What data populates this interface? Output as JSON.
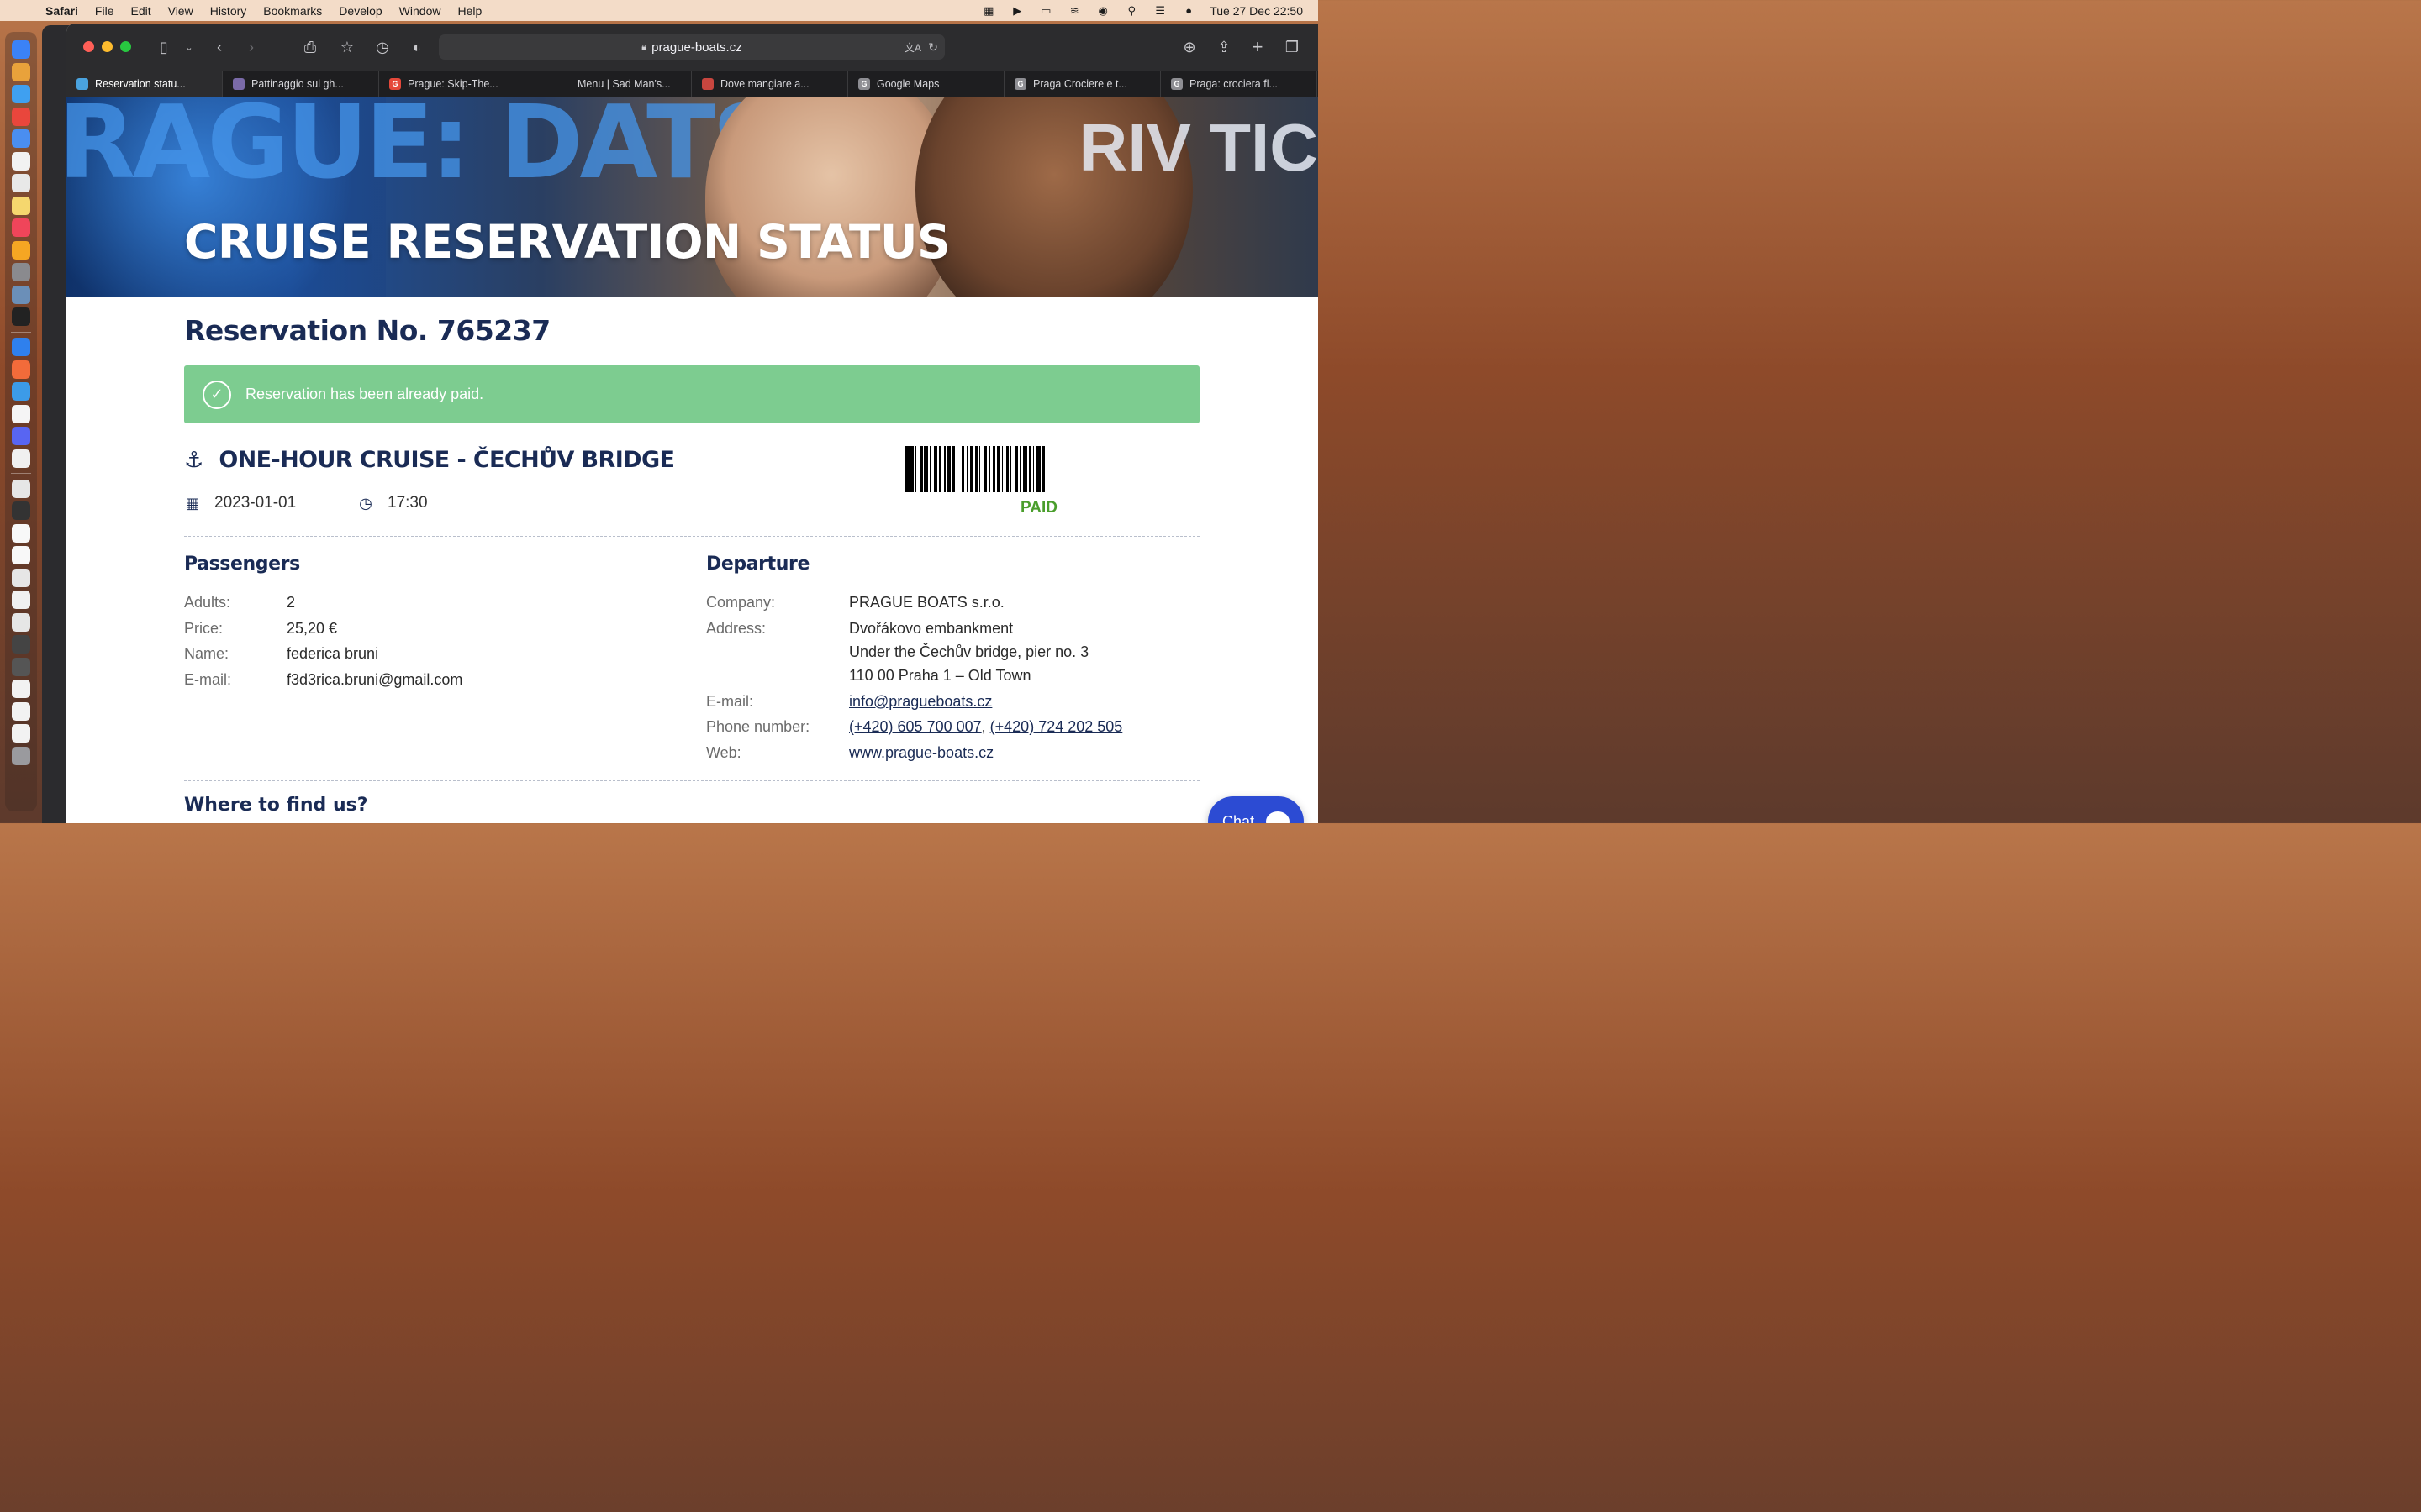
{
  "menubar": {
    "app_name": "Safari",
    "items": [
      "File",
      "Edit",
      "View",
      "History",
      "Bookmarks",
      "Develop",
      "Window",
      "Help"
    ],
    "clock": "Tue 27 Dec  22:50"
  },
  "browser": {
    "url": "prague-boats.cz",
    "tabs": [
      {
        "label": "Reservation statu...",
        "icon_color": "#4aa3df",
        "icon_letter": ""
      },
      {
        "label": "Pattinaggio sul gh...",
        "icon_color": "#7a6aa8",
        "icon_letter": ""
      },
      {
        "label": "Prague: Skip-The...",
        "icon_color": "#e5483a",
        "icon_letter": "G"
      },
      {
        "label": "Menu | Sad Man's...",
        "icon_color": "",
        "icon_letter": ""
      },
      {
        "label": "Dove mangiare a...",
        "icon_color": "#c8463f",
        "icon_letter": ""
      },
      {
        "label": "Google Maps",
        "icon_color": "#8e8e93",
        "icon_letter": "G"
      },
      {
        "label": "Praga Crociere e t...",
        "icon_color": "#8e8e93",
        "icon_letter": "G"
      },
      {
        "label": "Praga: crociera fl...",
        "icon_color": "#8e8e93",
        "icon_letter": "G"
      }
    ]
  },
  "hero": {
    "title": "CRUISE RESERVATION STATUS",
    "bg_text_left": "RAGUE: DATS:",
    "bg_text_right": "RIV TIC"
  },
  "reservation": {
    "title": "Reservation No. 765237",
    "alert_text": "Reservation has been already paid.",
    "cruise_name": "ONE-HOUR CRUISE - ČECHŮV BRIDGE",
    "date": "2023-01-01",
    "time": "17:30",
    "status": "PAID"
  },
  "passengers": {
    "heading": "Passengers",
    "rows": [
      {
        "label": "Adults:",
        "value": "2"
      },
      {
        "label": "Price:",
        "value": "25,20 €"
      },
      {
        "label": "Name:",
        "value": "federica bruni"
      },
      {
        "label": "E-mail:",
        "value": "f3d3rica.bruni@gmail.com"
      }
    ]
  },
  "departure": {
    "heading": "Departure",
    "company_label": "Company:",
    "company": "PRAGUE BOATS s.r.o.",
    "address_label": "Address:",
    "address_1": "Dvořákovo embankment",
    "address_2": "Under the Čechův bridge, pier no. 3",
    "address_3": "110 00 Praha 1 – Old Town",
    "email_label": "E-mail:",
    "email": "info@pragueboats.cz",
    "phone_label": "Phone number:",
    "phone_1": "(+420) 605 700 007",
    "phone_sep": ", ",
    "phone_2": "(+420) 724 202 505",
    "web_label": "Web:",
    "web": "www.prague-boats.cz"
  },
  "where_heading": "Where to find us?",
  "chat": {
    "label": "Chat"
  },
  "colors": {
    "brand_navy": "#1a2b55",
    "alert_green": "#7dcc90",
    "paid_green": "#4a9e2c",
    "chat_blue": "#2c4bd3"
  }
}
